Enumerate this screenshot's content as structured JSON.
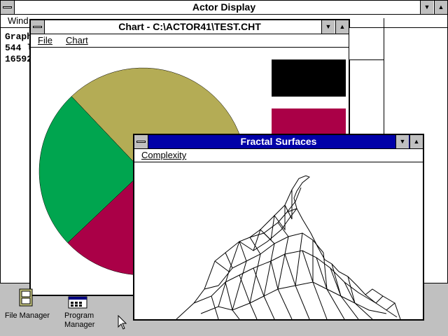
{
  "actor_window": {
    "title": "Actor Display",
    "menu_partial": "Wind",
    "lines": [
      "Graph",
      "544 l",
      "16592"
    ]
  },
  "chart_window": {
    "title": "Chart - C:\\ACTOR41\\TEST.CHT",
    "menus": [
      "File",
      "Chart"
    ],
    "colors": {
      "olive": "#b4ac55",
      "green": "#00a54f",
      "crimson": "#aa0047",
      "black": "#000000"
    },
    "chart_data": {
      "type": "pie",
      "slices": [
        {
          "color": "#b4ac55",
          "value": 41
        },
        {
          "color": "#aa0047",
          "value": 34
        },
        {
          "color": "#00a54f",
          "value": 25
        }
      ]
    }
  },
  "fractal_window": {
    "title": "Fractal Surfaces",
    "menus": [
      "Complexity"
    ]
  },
  "desktop_icons": [
    {
      "label": "File Manager",
      "icon": "file-cabinet-icon"
    },
    {
      "label_line1": "Program",
      "label_line2": "Manager",
      "icon": "program-manager-icon"
    }
  ]
}
